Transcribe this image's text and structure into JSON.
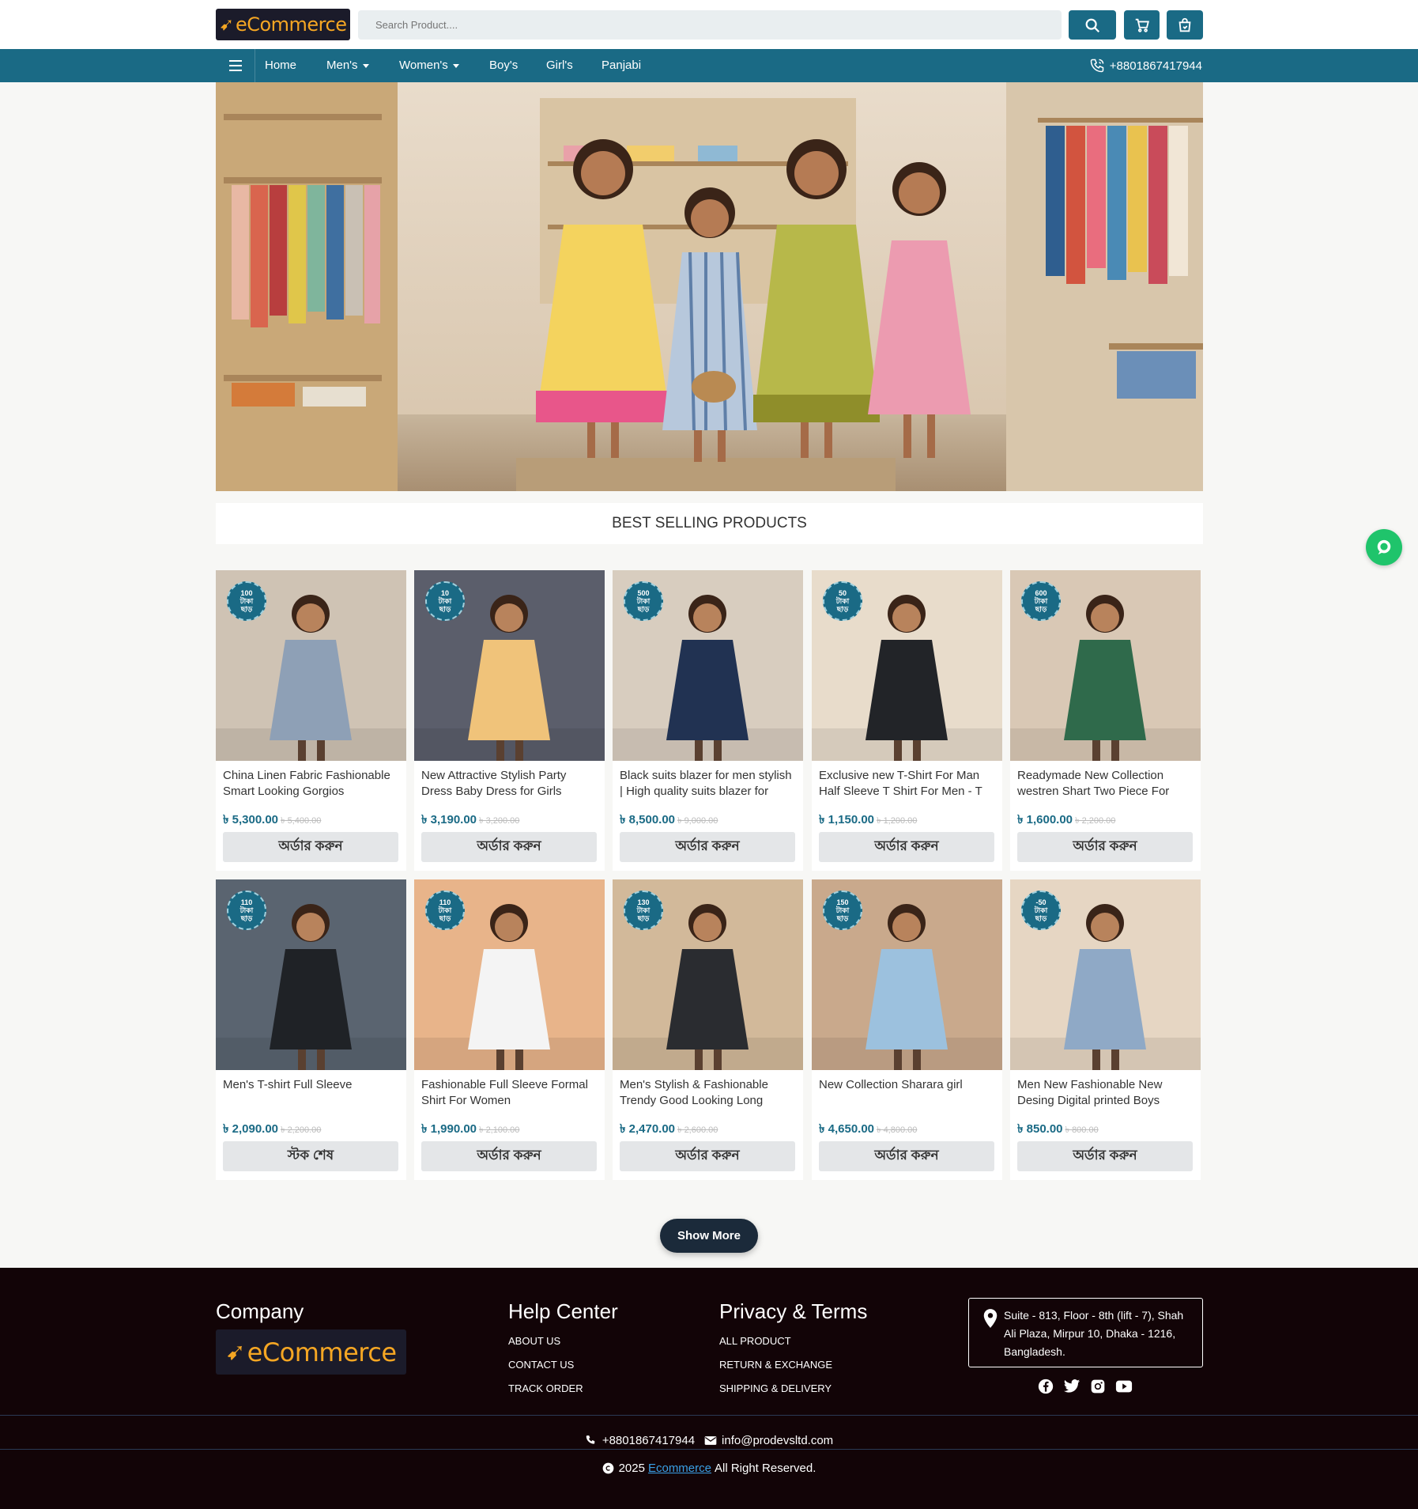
{
  "header": {
    "logo_text": "eCommerce",
    "search_placeholder": "Search Product....",
    "icons": [
      "search-icon",
      "cart-icon",
      "shopping-bag-icon"
    ]
  },
  "nav": {
    "items": [
      {
        "label": "Home",
        "dropdown": false
      },
      {
        "label": "Men's",
        "dropdown": true
      },
      {
        "label": "Women's",
        "dropdown": true
      },
      {
        "label": "Boy's",
        "dropdown": false
      },
      {
        "label": "Girl's",
        "dropdown": false
      },
      {
        "label": "Panjabi",
        "dropdown": false
      }
    ],
    "phone": "+8801867417944"
  },
  "section": {
    "title": "BEST SELLING PRODUCTS"
  },
  "products": [
    {
      "title": "China Linen Fabric Fashionable Smart Looking Gorgios",
      "price": "৳ 5,300.00",
      "old_price": "৳ 5,400.00",
      "badge_amount": "100",
      "badge_line1": "টাকা",
      "badge_line2": "ছাড়",
      "button": "অর্ডার করুন",
      "img_bg": "#cfc3b4",
      "img_fg": "#8ea0b6"
    },
    {
      "title": "New Attractive Stylish Party Dress Baby Dress for Girls",
      "price": "৳ 3,190.00",
      "old_price": "৳ 3,200.00",
      "badge_amount": "10",
      "badge_line1": "টাকা",
      "badge_line2": "ছাড়",
      "button": "অর্ডার করুন",
      "img_bg": "#5b5e6b",
      "img_fg": "#f0c37a"
    },
    {
      "title": "Black suits blazer for men stylish | High quality suits blazer for",
      "price": "৳ 8,500.00",
      "old_price": "৳ 9,000.00",
      "badge_amount": "500",
      "badge_line1": "টাকা",
      "badge_line2": "ছাড়",
      "button": "অর্ডার করুন",
      "img_bg": "#d8cdbf",
      "img_fg": "#213252"
    },
    {
      "title": "Exclusive new T-Shirt For Man Half Sleeve T Shirt For Men - T",
      "price": "৳ 1,150.00",
      "old_price": "৳ 1,200.00",
      "badge_amount": "50",
      "badge_line1": "টাকা",
      "badge_line2": "ছাড়",
      "button": "অর্ডার করুন",
      "img_bg": "#e8dccb",
      "img_fg": "#222428"
    },
    {
      "title": "Readymade New Collection westren Shart Two Piece For",
      "price": "৳ 1,600.00",
      "old_price": "৳ 2,200.00",
      "badge_amount": "600",
      "badge_line1": "টাকা",
      "badge_line2": "ছাড়",
      "button": "অর্ডার করুন",
      "img_bg": "#d9c8b5",
      "img_fg": "#2f6a4b"
    },
    {
      "title": "Men's T-shirt Full Sleeve",
      "price": "৳ 2,090.00",
      "old_price": "৳ 2,200.00",
      "badge_amount": "110",
      "badge_line1": "টাকা",
      "badge_line2": "ছাড়",
      "button": "স্টক শেষ",
      "img_bg": "#5a6470",
      "img_fg": "#1f2226"
    },
    {
      "title": "Fashionable Full Sleeve Formal Shirt For Women",
      "price": "৳ 1,990.00",
      "old_price": "৳ 2,100.00",
      "badge_amount": "110",
      "badge_line1": "টাকা",
      "badge_line2": "ছাড়",
      "button": "অর্ডার করুন",
      "img_bg": "#e8b48a",
      "img_fg": "#f4f4f4"
    },
    {
      "title": "Men's Stylish & Fashionable Trendy Good Looking Long",
      "price": "৳ 2,470.00",
      "old_price": "৳ 2,600.00",
      "badge_amount": "130",
      "badge_line1": "টাকা",
      "badge_line2": "ছাড়",
      "button": "অর্ডার করুন",
      "img_bg": "#d2b99a",
      "img_fg": "#2a2c30"
    },
    {
      "title": "New Collection Sharara girl",
      "price": "৳ 4,650.00",
      "old_price": "৳ 4,800.00",
      "badge_amount": "150",
      "badge_line1": "টাকা",
      "badge_line2": "ছাড়",
      "button": "অর্ডার করুন",
      "img_bg": "#c9a98c",
      "img_fg": "#9cc1de"
    },
    {
      "title": "Men New Fashionable New Desing Digital printed Boys",
      "price": "৳ 850.00",
      "old_price": "৳ 800.00",
      "badge_amount": "-50",
      "badge_line1": "টাকা",
      "badge_line2": "ছাড়",
      "button": "অর্ডার করুন",
      "img_bg": "#e6d6c3",
      "img_fg": "#8fa9c6"
    }
  ],
  "show_more": "Show More",
  "footer": {
    "company_heading": "Company",
    "logo_text": "eCommerce",
    "help_heading": "Help Center",
    "help_links": [
      "ABOUT US",
      "CONTACT US",
      "TRACK ORDER"
    ],
    "privacy_heading": "Privacy & Terms",
    "privacy_links": [
      "ALL PRODUCT",
      "RETURN & EXCHANGE",
      "SHIPPING & DELIVERY"
    ],
    "address": "Suite - 813, Floor - 8th (lift - 7), Shah Ali Plaza, Mirpur 10, Dhaka - 1216, Bangladesh.",
    "social": [
      "facebook-icon",
      "twitter-icon",
      "instagram-icon",
      "youtube-icon"
    ],
    "phone": "+8801867417944",
    "email": "info@prodevsltd.com",
    "copyright_year": "2025",
    "copyright_link": "Ecommerce",
    "copyright_rest": "All Right Reserved."
  },
  "colors": {
    "primary": "#1a6a85",
    "footer_bg": "#120407",
    "logo": "#f5a623",
    "chat": "#1fc46b"
  }
}
